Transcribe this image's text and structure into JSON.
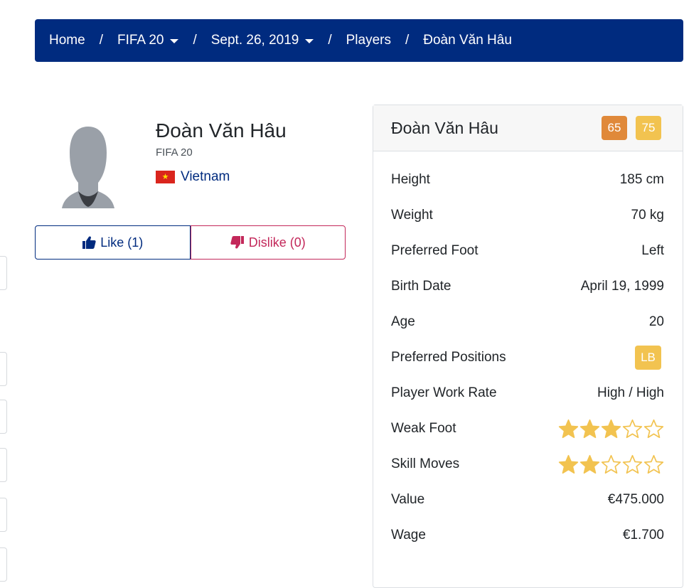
{
  "breadcrumb": {
    "home": "Home",
    "game": "FIFA 20",
    "date": "Sept. 26, 2019",
    "players": "Players",
    "current": "Đoàn Văn Hâu",
    "separator": "/"
  },
  "player": {
    "name": "Đoàn Văn Hâu",
    "version": "FIFA 20",
    "nation": "Vietnam",
    "like_label": "Like (1)",
    "dislike_label": "Dislike (0)"
  },
  "card": {
    "title": "Đoàn Văn Hâu",
    "overall": "65",
    "potential": "75",
    "rows": [
      {
        "label": "Height",
        "value": "185 cm"
      },
      {
        "label": "Weight",
        "value": "70 kg"
      },
      {
        "label": "Preferred Foot",
        "value": "Left"
      },
      {
        "label": "Birth Date",
        "value": "April 19, 1999"
      },
      {
        "label": "Age",
        "value": "20"
      },
      {
        "label": "Preferred Positions",
        "value": "LB"
      },
      {
        "label": "Player Work Rate",
        "value": "High / High"
      },
      {
        "label": "Weak Foot",
        "stars": 3
      },
      {
        "label": "Skill Moves",
        "stars": 2
      },
      {
        "label": "Value",
        "value": "€475.000"
      },
      {
        "label": "Wage",
        "value": "€1.700"
      }
    ]
  },
  "colors": {
    "nav": "#002b7f",
    "like": "#002b7f",
    "dislike": "#c3285a",
    "overall_badge": "#e0893a",
    "potential_badge": "#f2c350",
    "star": "#f2c350"
  },
  "icons": [
    "thumbs-up-icon",
    "thumbs-down-icon",
    "caret-down-icon",
    "star-icon",
    "vietnam-flag-icon"
  ]
}
